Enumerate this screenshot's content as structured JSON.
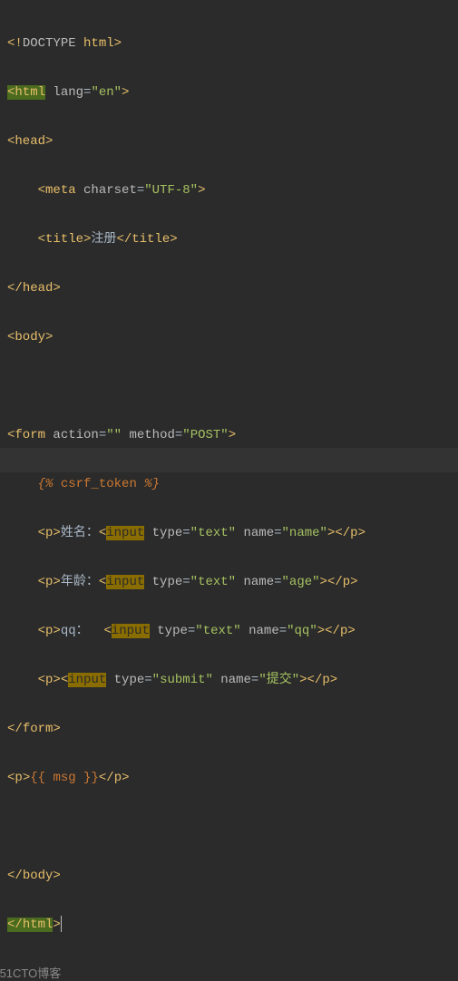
{
  "lines": {
    "l1": {
      "doctype_open": "<!",
      "doctype_word": "DOCTYPE",
      "doctype_space": " ",
      "doctype_html": "html",
      "doctype_close": ">"
    },
    "l2": {
      "open": "<",
      "tag_html": "html",
      "sp": " ",
      "attr_lang": "lang",
      "eq": "=",
      "val_en": "\"en\"",
      "close": ">"
    },
    "l3": {
      "open": "<",
      "tag_head": "head",
      "close": ">"
    },
    "l4": {
      "indent": "    ",
      "open": "<",
      "tag_meta": "meta",
      "sp": " ",
      "attr_charset": "charset",
      "eq": "=",
      "val_utf8": "\"UTF-8\"",
      "close": ">"
    },
    "l5": {
      "indent": "    ",
      "open1": "<",
      "tag_title": "title",
      "close1": ">",
      "text_title": "注册",
      "open2": "</",
      "tag_title2": "title",
      "close2": ">"
    },
    "l6": {
      "open": "</",
      "tag_head": "head",
      "close": ">"
    },
    "l7": {
      "open": "<",
      "tag_body": "body",
      "close": ">"
    },
    "l8": {
      "blank": " "
    },
    "l9": {
      "open": "<",
      "tag_form": "form",
      "sp1": " ",
      "attr_action": "action",
      "eq1": "=",
      "val_action": "\"\"",
      "sp2": " ",
      "attr_method": "method",
      "eq2": "=",
      "val_method": "\"POST\"",
      "close": ">"
    },
    "l10": {
      "indent": "    ",
      "open_d": "{% ",
      "csrf": "csrf_token",
      "close_d": " %}"
    },
    "l11": {
      "indent": "    ",
      "p_open": "<",
      "p_tag": "p",
      "p_close": ">",
      "label": "姓名：",
      "inp_open": "<",
      "inp_tag": "input",
      "sp1": " ",
      "attr_type": "type",
      "eq1": "=",
      "val_type": "\"text\"",
      "sp2": " ",
      "attr_name": "name",
      "eq2": "=",
      "val_name": "\"name\"",
      "inp_close": ">",
      "p_end_open": "</",
      "p_tag2": "p",
      "p_end_close": ">"
    },
    "l12": {
      "indent": "    ",
      "p_open": "<",
      "p_tag": "p",
      "p_close": ">",
      "label": "年龄：",
      "inp_open": "<",
      "inp_tag": "input",
      "sp1": " ",
      "attr_type": "type",
      "eq1": "=",
      "val_type": "\"text\"",
      "sp2": " ",
      "attr_name": "name",
      "eq2": "=",
      "val_name": "\"age\"",
      "inp_close": ">",
      "p_end_open": "</",
      "p_tag2": "p",
      "p_end_close": ">"
    },
    "l13": {
      "indent": "    ",
      "p_open": "<",
      "p_tag": "p",
      "p_close": ">",
      "label": "qq：  ",
      "inp_open": "<",
      "inp_tag": "input",
      "sp1": " ",
      "attr_type": "type",
      "eq1": "=",
      "val_type": "\"text\"",
      "sp2": " ",
      "attr_name": "name",
      "eq2": "=",
      "val_name": "\"qq\"",
      "inp_close": ">",
      "p_end_open": "</",
      "p_tag2": "p",
      "p_end_close": ">"
    },
    "l14": {
      "indent": "    ",
      "p_open": "<",
      "p_tag": "p",
      "p_close": ">",
      "inp_open": "<",
      "inp_tag": "input",
      "sp1": " ",
      "attr_type": "type",
      "eq1": "=",
      "val_type": "\"submit\"",
      "sp2": " ",
      "attr_name": "name",
      "eq2": "=",
      "val_name": "\"提交\"",
      "inp_close": ">",
      "p_end_open": "</",
      "p_tag2": "p",
      "p_end_close": ">"
    },
    "l15": {
      "open": "</",
      "tag_form": "form",
      "close": ">"
    },
    "l16": {
      "p_open": "<",
      "p_tag": "p",
      "p_close": ">",
      "mo": "{{ ",
      "msg": "msg",
      "mc": " }}",
      "p_end_open": "</",
      "p_tag2": "p",
      "p_end_close": ">"
    },
    "l17": {
      "blank": " "
    },
    "l18": {
      "open": "</",
      "tag_body": "body",
      "close": ">"
    },
    "l19": {
      "open": "</",
      "tag_html": "html",
      "close": ">"
    }
  },
  "watermark": "©51CTO博客"
}
